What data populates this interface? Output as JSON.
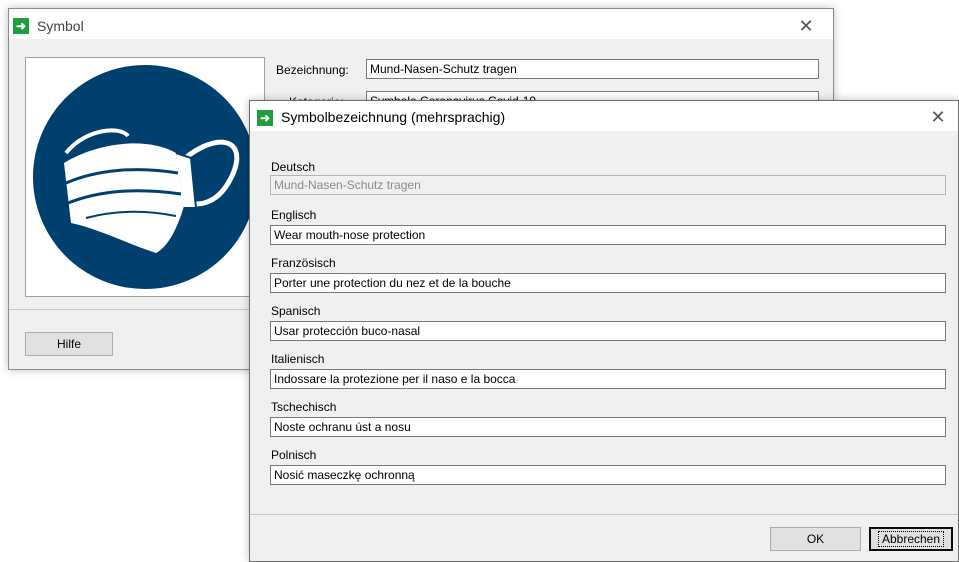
{
  "symbol_dialog": {
    "title": "Symbol",
    "bezeichnung_label": "Bezeichnung:",
    "bezeichnung_value": "Mund-Nasen-Schutz tragen",
    "kategorie_label": "Kategorie:",
    "kategorie_value": "Symbole Coronavirus Covid-19",
    "help_button": "Hilfe",
    "close_icon": "close-icon",
    "symbol_icon": "face-mask-icon",
    "symbol_color": "#00406e"
  },
  "lang_dialog": {
    "title": "Symbolbezeichnung (mehrsprachig)",
    "close_icon": "close-icon",
    "languages": [
      {
        "label": "Deutsch",
        "value": "Mund-Nasen-Schutz tragen"
      },
      {
        "label": "Englisch",
        "value": "Wear mouth-nose protection"
      },
      {
        "label": "Französisch",
        "value": "Porter une protection du nez et de la bouche"
      },
      {
        "label": "Spanisch",
        "value": "Usar protección buco-nasal"
      },
      {
        "label": "Italienisch",
        "value": "Indossare la protezione per il naso e la bocca"
      },
      {
        "label": "Tschechisch",
        "value": "Noste ochranu úst a nosu"
      },
      {
        "label": "Polnisch",
        "value": "Nosić maseczkę ochronną"
      }
    ],
    "ok_button": "OK",
    "cancel_button": "Abbrechen"
  },
  "colors": {
    "app_icon": "#1e9e3c",
    "dialog_bg": "#f0f0f0",
    "title_bg": "#ffffff"
  }
}
